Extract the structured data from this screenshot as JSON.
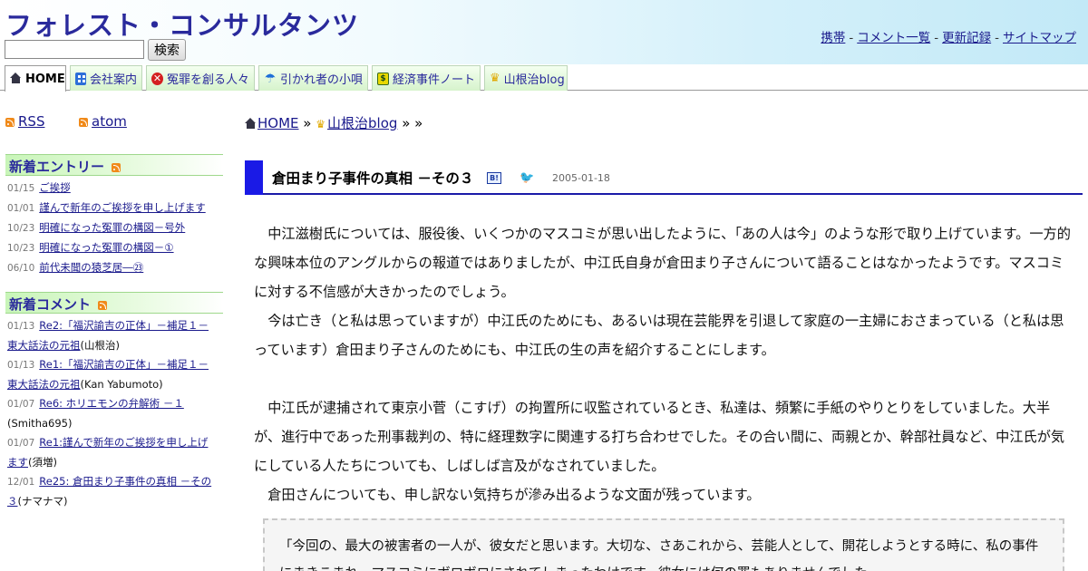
{
  "header": {
    "site_title": "フォレスト・コンサルタンツ",
    "search_value": "",
    "search_button": "検索",
    "top_links": [
      "携帯",
      "コメント一覧",
      "更新記録",
      "サイトマップ"
    ],
    "sep": "-"
  },
  "nav": {
    "tabs": [
      {
        "label": "HOME",
        "icon": "home-icon"
      },
      {
        "label": "会社案内",
        "icon": "grid-icon"
      },
      {
        "label": "冤罪を創る人々",
        "icon": "no-entry-icon"
      },
      {
        "label": "引かれ者の小唄",
        "icon": "umbrella-icon"
      },
      {
        "label": "経済事件ノート",
        "icon": "money-icon"
      },
      {
        "label": "山根治blog",
        "icon": "crown-icon"
      }
    ]
  },
  "sidebar": {
    "feeds": [
      "RSS",
      "atom"
    ],
    "entries_heading": "新着エントリー",
    "entries": [
      {
        "date": "01/15",
        "title": "ご挨拶"
      },
      {
        "date": "01/01",
        "title": "謹んで新年のご挨拶を申し上げます"
      },
      {
        "date": "10/23",
        "title": "明確になった冤罪の構図－号外"
      },
      {
        "date": "10/23",
        "title": "明確になった冤罪の構図－①"
      },
      {
        "date": "06/10",
        "title": "前代未聞の猿芝居―㉓"
      }
    ],
    "comments_heading": "新着コメント",
    "comments": [
      {
        "date": "01/13",
        "line1": "Re2:「福沢諭吉の正体」－補足１－",
        "line2": "東大話法の元祖",
        "who": "(山根治)"
      },
      {
        "date": "01/13",
        "line1": "Re1:「福沢諭吉の正体」－補足１－",
        "line2": "東大話法の元祖",
        "who": "(Kan Yabumoto)"
      },
      {
        "date": "01/07",
        "line1": "Re6: ホリエモンの弁解術 －１",
        "line2": "",
        "who": "(Smitha695)"
      },
      {
        "date": "01/07",
        "line1": "Re1:謹んで新年のご挨拶を申し上げ",
        "line2": "ます",
        "who": "(須増)"
      },
      {
        "date": "12/01",
        "line1": "Re25: 倉田まり子事件の真相 －その",
        "line2": "３",
        "who": "(ナマナマ)"
      }
    ]
  },
  "main": {
    "breadcrumb": {
      "home": "HOME",
      "sep": "»",
      "blog": "山根治blog",
      "tail": "»"
    },
    "entry_title": "倉田まり子事件の真相 －その３",
    "hatena_label": "B!",
    "entry_date": "2005-01-18",
    "paragraphs": [
      "中江滋樹氏については、服役後、いくつかのマスコミが思い出したように、「あの人は今」のような形で取り上げています。一方的な興味本位のアングルからの報道ではありましたが、中江氏自身が倉田まり子さんについて語ることはなかったようです。マスコミに対する不信感が大きかったのでしょう。",
      "今は亡き（と私は思っていますが）中江氏のためにも、あるいは現在芸能界を引退して家庭の一主婦におさまっている（と私は思っています）倉田まり子さんのためにも、中江氏の生の声を紹介することにします。",
      "中江氏が逮捕されて東京小菅（こすげ）の拘置所に収監されているとき、私達は、頻繁に手紙のやりとりをしていました。大半が、進行中であった刑事裁判の、特に経理数字に関連する打ち合わせでした。その合い間に、両親とか、幹部社員など、中江氏が気にしている人たちについても、しばしば言及がなされていました。",
      "倉田さんについても、申し訳ない気持ちが滲み出るような文面が残っています。"
    ],
    "quote": "「今回の、最大の被害者の一人が、彼女だと思います。大切な、さあこれから、芸能人として、開花しようとする時に、私の事件にまきこまれ、マスコミにボロボロにされてしまったわけです。彼女には何の罪もありませんでした。"
  }
}
